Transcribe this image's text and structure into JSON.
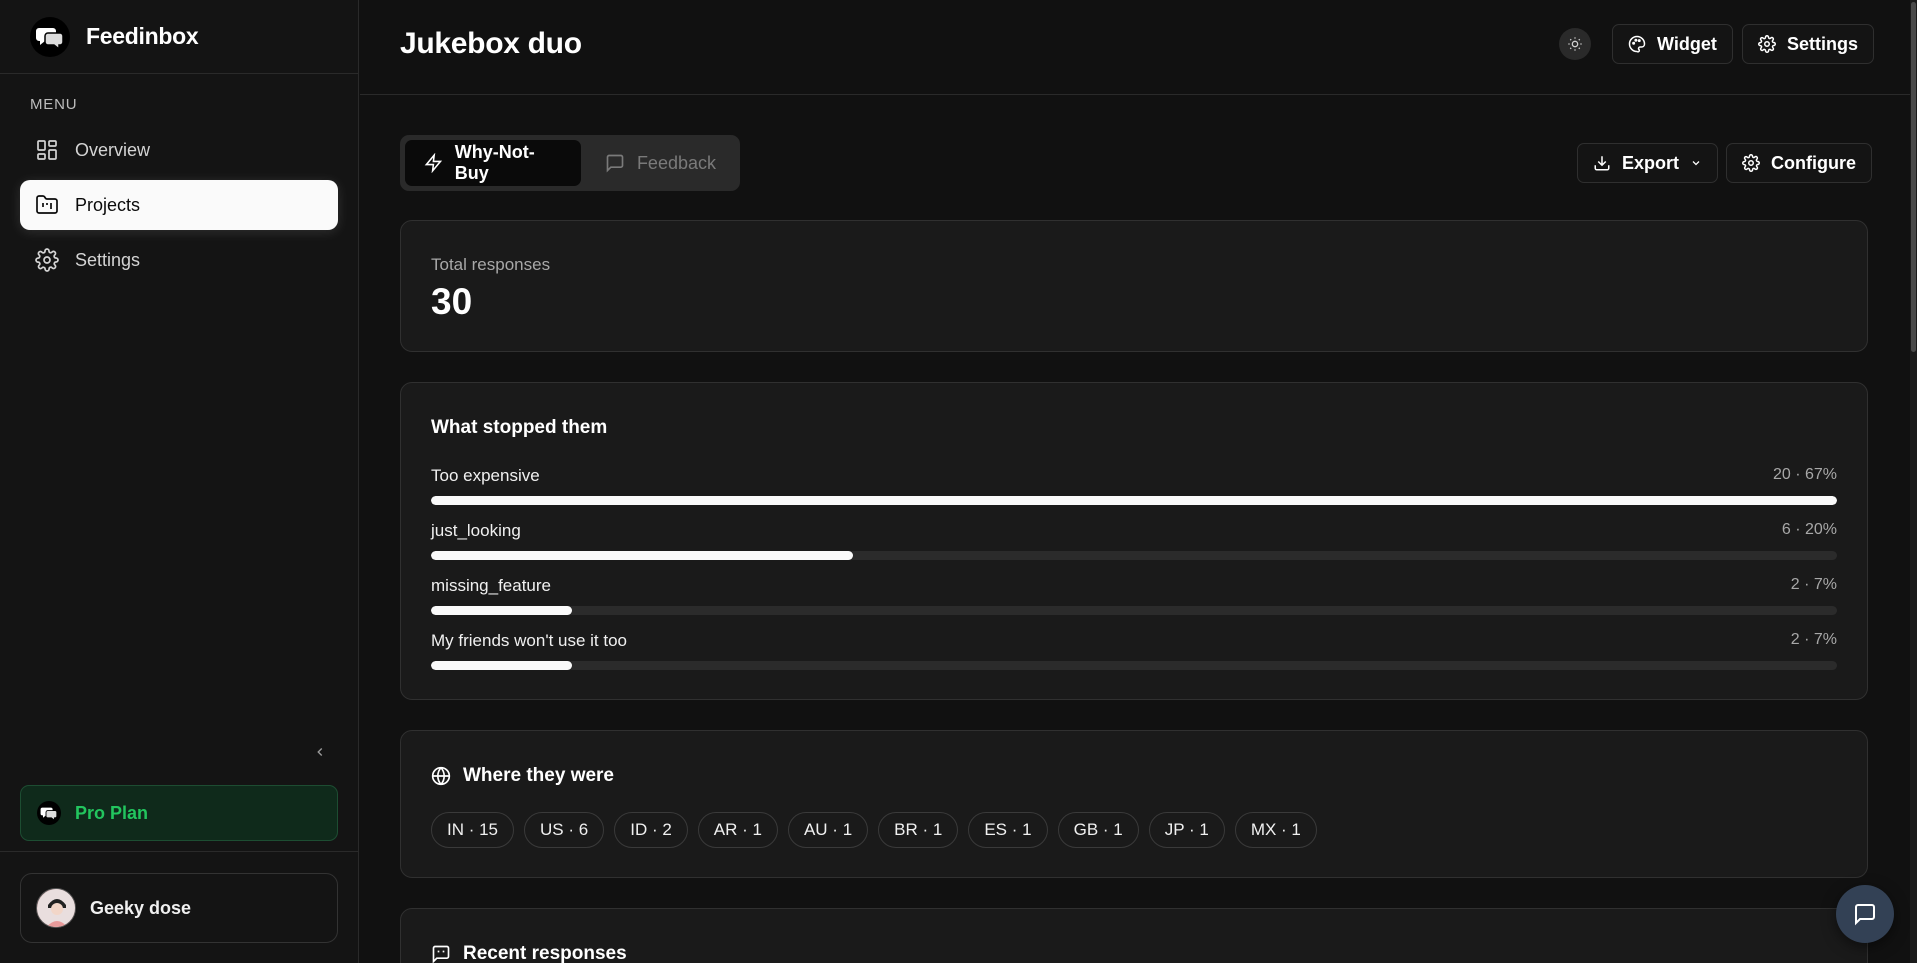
{
  "app": {
    "name": "Feedinbox"
  },
  "sidebar": {
    "menu_label": "MENU",
    "items": [
      {
        "label": "Overview",
        "icon": "layout-grid-icon"
      },
      {
        "label": "Projects",
        "icon": "folder-kanban-icon",
        "active": true
      },
      {
        "label": "Settings",
        "icon": "gear-icon"
      }
    ],
    "plan_label": "Pro Plan",
    "user_name": "Geeky dose"
  },
  "header": {
    "title": "Jukebox duo",
    "widget_label": "Widget",
    "settings_label": "Settings"
  },
  "tabs": [
    {
      "label": "Why-Not-Buy",
      "icon": "zap-icon",
      "active": true
    },
    {
      "label": "Feedback",
      "icon": "message-square-icon",
      "active": false
    }
  ],
  "actions": {
    "export_label": "Export",
    "configure_label": "Configure"
  },
  "total": {
    "label": "Total responses",
    "value": "30"
  },
  "reasons": {
    "title": "What stopped them",
    "items": [
      {
        "label": "Too expensive",
        "meta": "20 · 67%",
        "fraction": 1.0
      },
      {
        "label": "just_looking",
        "meta": "6 · 20%",
        "fraction": 0.3
      },
      {
        "label": "missing_feature",
        "meta": "2 · 7%",
        "fraction": 0.1
      },
      {
        "label": "My friends won't use it too",
        "meta": "2 · 7%",
        "fraction": 0.1
      }
    ]
  },
  "locations": {
    "title": "Where they were",
    "chips": [
      "IN · 15",
      "US · 6",
      "ID · 2",
      "AR · 1",
      "AU · 1",
      "BR · 1",
      "ES · 1",
      "GB · 1",
      "JP · 1",
      "MX · 1"
    ]
  },
  "recent": {
    "title": "Recent responses"
  },
  "colors": {
    "background": "#111111",
    "accent_green": "#22c55e",
    "bar_fill": "#fafafa",
    "chat_button": "#334155"
  }
}
